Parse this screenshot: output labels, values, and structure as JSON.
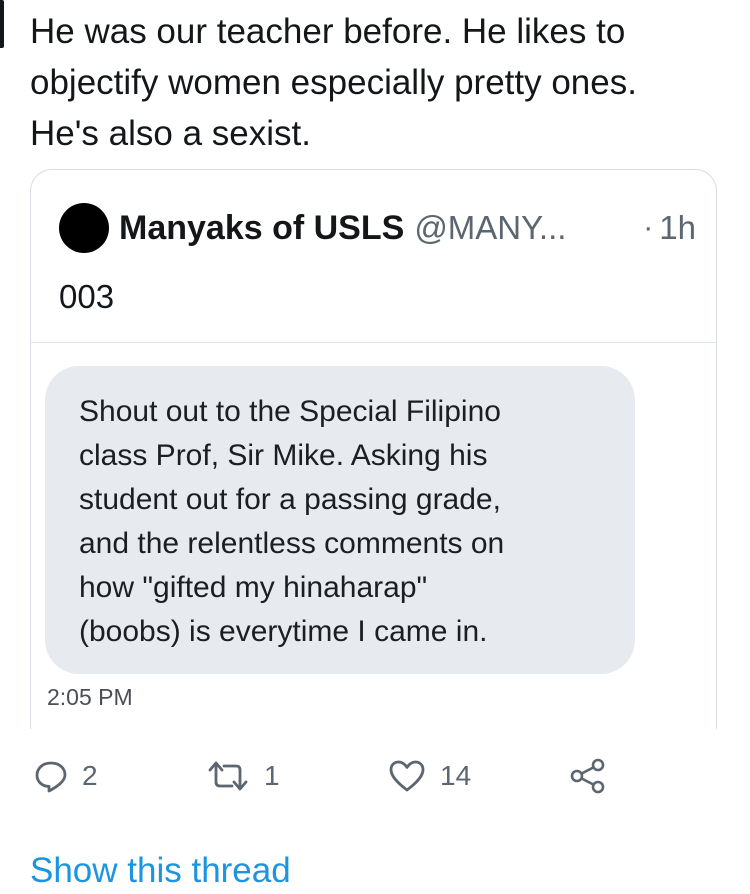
{
  "tweet": {
    "text": "He was our teacher before. He likes to\nobjectify women especially pretty ones.\nHe's also a sexist."
  },
  "quote": {
    "display_name": "Manyaks of USLS",
    "handle": "@MANY...",
    "separator": "·",
    "time_ago": "1h",
    "text": "003",
    "media": {
      "text": "Shout out to the Special Filipino\nclass Prof, Sir Mike. Asking his\nstudent out for a passing grade,\nand the relentless comments on\nhow \"gifted my hinaharap\"\n(boobs) is everytime I came in.",
      "timestamp": "2:05 PM"
    }
  },
  "actions": {
    "reply": {
      "icon": "reply-icon",
      "count": "2"
    },
    "retweet": {
      "icon": "retweet-icon",
      "count": "1"
    },
    "like": {
      "icon": "heart-icon",
      "count": "14"
    },
    "share": {
      "icon": "share-icon"
    }
  },
  "show_thread_label": "Show this thread",
  "colors": {
    "link": "#1b95e0",
    "secondary_text": "#5b6670",
    "media_background": "#e7eaee"
  }
}
